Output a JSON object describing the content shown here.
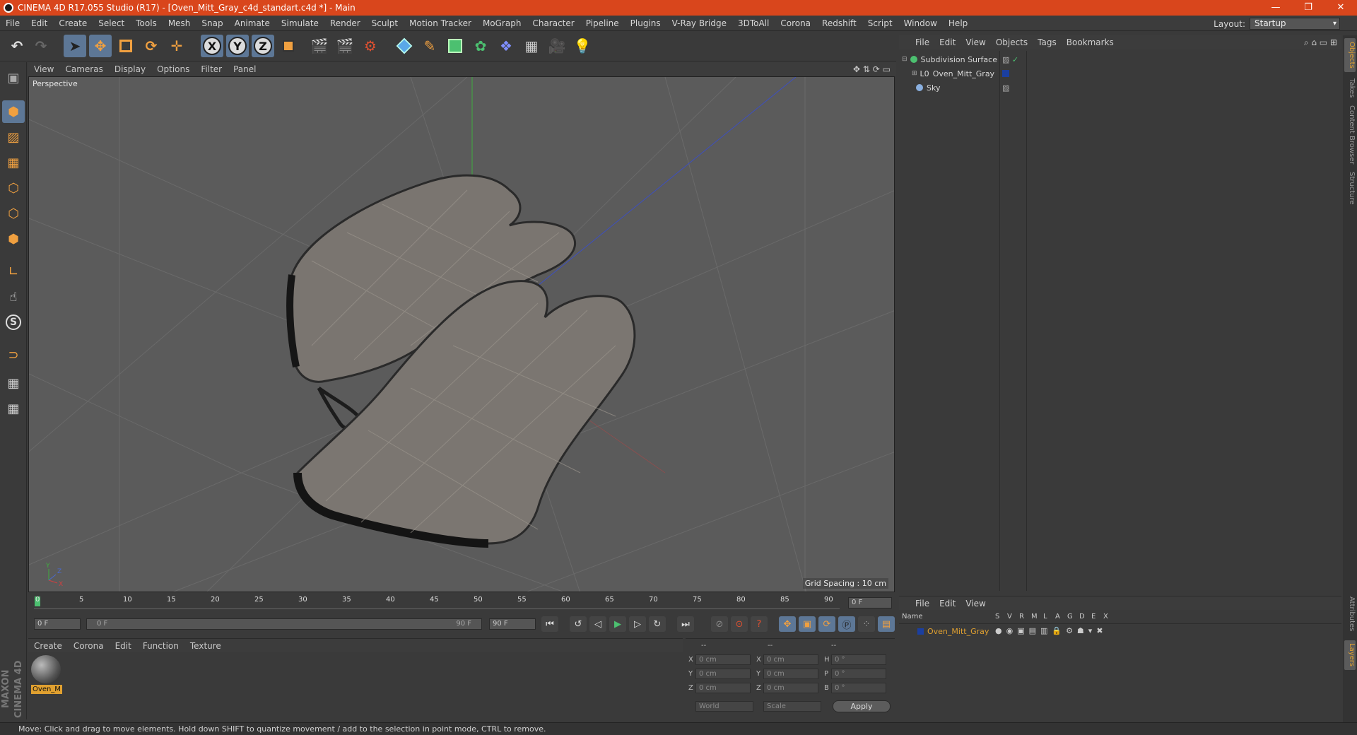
{
  "window": {
    "title": "CINEMA 4D R17.055 Studio (R17) - [Oven_Mitt_Gray_c4d_standart.c4d *] - Main",
    "minimize": "—",
    "restore": "❐",
    "close": "✕"
  },
  "menu": [
    "File",
    "Edit",
    "Create",
    "Select",
    "Tools",
    "Mesh",
    "Snap",
    "Animate",
    "Simulate",
    "Render",
    "Sculpt",
    "Motion Tracker",
    "MoGraph",
    "Character",
    "Pipeline",
    "Plugins",
    "V-Ray Bridge",
    "3DToAll",
    "Corona",
    "Redshift",
    "Script",
    "Window",
    "Help"
  ],
  "layout": {
    "label": "Layout:",
    "value": "Startup"
  },
  "viewport": {
    "menu": [
      "View",
      "Cameras",
      "Display",
      "Options",
      "Filter",
      "Panel"
    ],
    "label": "Perspective",
    "grid_spacing": "Grid Spacing : 10 cm"
  },
  "timeline": {
    "ticks": [
      "0",
      "5",
      "10",
      "15",
      "20",
      "25",
      "30",
      "35",
      "40",
      "45",
      "50",
      "55",
      "60",
      "65",
      "70",
      "75",
      "80",
      "85",
      "90"
    ],
    "current_frame": "0 F",
    "start_field": "0 F",
    "range_start": "0 F",
    "range_end": "90 F",
    "end_field": "90 F"
  },
  "material_manager": {
    "menu": [
      "Create",
      "Corona",
      "Edit",
      "Function",
      "Texture"
    ],
    "material_name": "Oven_M"
  },
  "coordinates": {
    "headers": [
      "--",
      "--",
      "--"
    ],
    "rows": [
      {
        "a": "X",
        "av": "0 cm",
        "b": "X",
        "bv": "0 cm",
        "c": "H",
        "cv": "0 °"
      },
      {
        "a": "Y",
        "av": "0 cm",
        "b": "Y",
        "bv": "0 cm",
        "c": "P",
        "cv": "0 °"
      },
      {
        "a": "Z",
        "av": "0 cm",
        "b": "Z",
        "bv": "0 cm",
        "c": "B",
        "cv": "0 °"
      }
    ],
    "world": "World",
    "scale": "Scale",
    "apply": "Apply"
  },
  "object_manager": {
    "menu": [
      "File",
      "Edit",
      "View",
      "Objects",
      "Tags",
      "Bookmarks"
    ],
    "objects": [
      {
        "name": "Subdivision Surface",
        "icon": "subdivision-icon"
      },
      {
        "name": "Oven_Mitt_Gray",
        "icon": "null-object-icon"
      },
      {
        "name": "Sky",
        "icon": "sky-icon"
      }
    ]
  },
  "layer_manager": {
    "menu": [
      "File",
      "Edit",
      "View"
    ],
    "columns": [
      "Name",
      "S",
      "V",
      "R",
      "M",
      "L",
      "A",
      "G",
      "D",
      "E",
      "X"
    ],
    "layers": [
      {
        "name": "Oven_Mitt_Gray",
        "color": "#1b3fa0"
      }
    ]
  },
  "side_tabs": [
    "Objects",
    "Takes",
    "Content Browser",
    "Structure",
    "Attributes",
    "Layers"
  ],
  "status": "Move: Click and drag to move elements. Hold down SHIFT to quantize movement / add to the selection in point mode, CTRL to remove.",
  "brand": "MAXON CINEMA 4D",
  "colors": {
    "titlebar": "#d9461c",
    "accent": "#e0a030",
    "active_tool": "#5d7796"
  }
}
